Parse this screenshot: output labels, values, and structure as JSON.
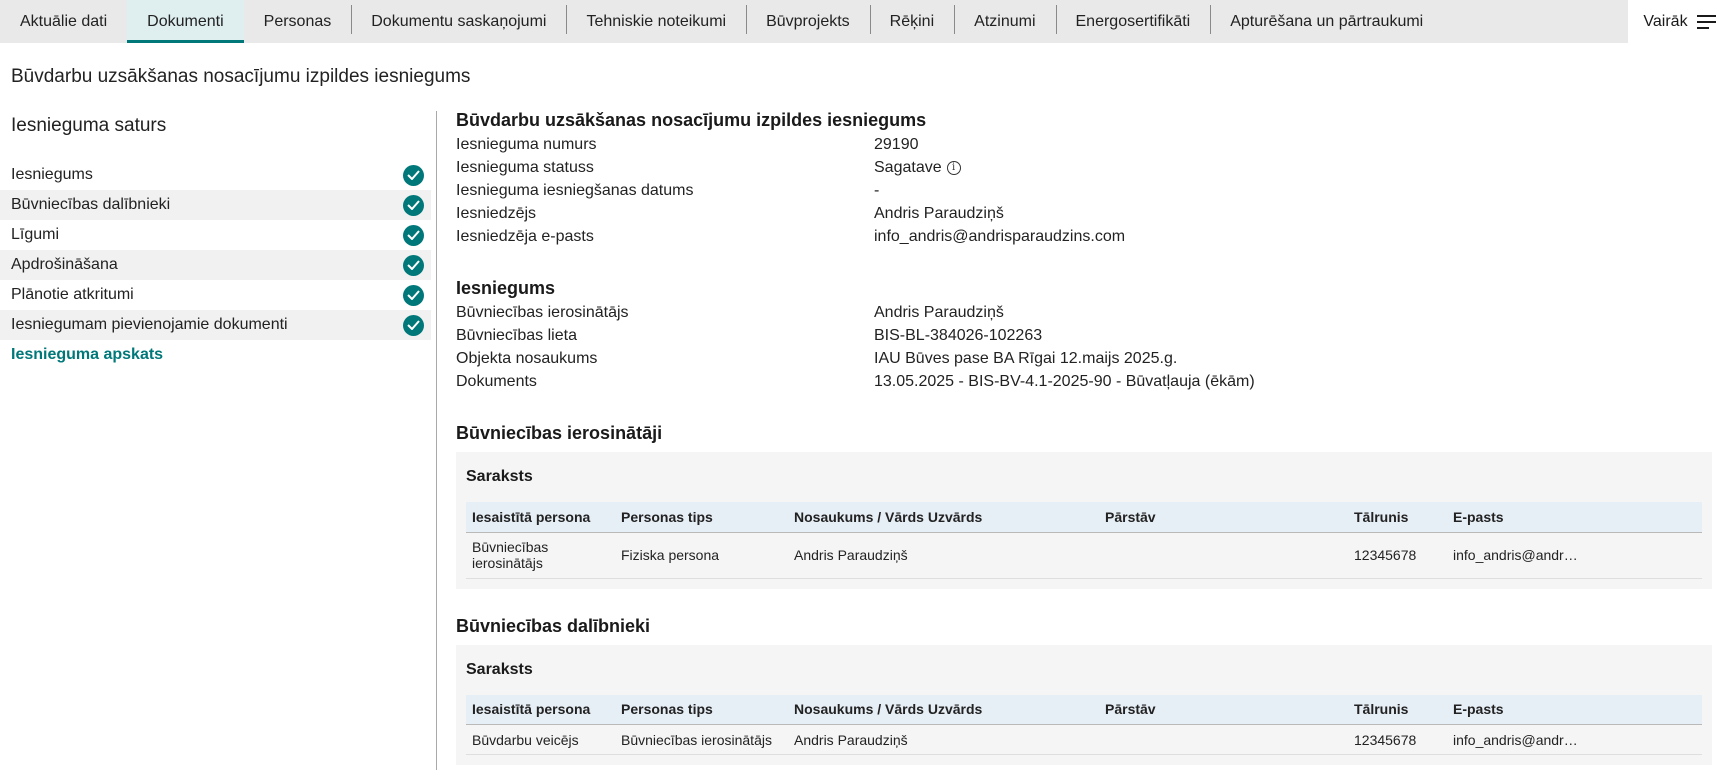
{
  "tabs": [
    {
      "label": "Aktuālie dati"
    },
    {
      "label": "Dokumenti"
    },
    {
      "label": "Personas"
    },
    {
      "label": "Dokumentu saskaņojumi"
    },
    {
      "label": "Tehniskie noteikumi"
    },
    {
      "label": "Būvprojekts"
    },
    {
      "label": "Rēķini"
    },
    {
      "label": "Atzinumi"
    },
    {
      "label": "Energosertifikāti"
    },
    {
      "label": "Apturēšana un pārtraukumi"
    }
  ],
  "active_tab": "Dokumenti",
  "more_label": "Vairāk",
  "page_title": "Būvdarbu uzsākšanas nosacījumu izpildes iesniegums",
  "sidebar": {
    "title": "Iesnieguma saturs",
    "items": [
      {
        "label": "Iesniegums",
        "status": "complete"
      },
      {
        "label": "Būvniecības dalībnieki",
        "status": "complete"
      },
      {
        "label": "Līgumi",
        "status": "complete"
      },
      {
        "label": "Apdrošināšana",
        "status": "complete"
      },
      {
        "label": "Plānotie atkritumi",
        "status": "complete"
      },
      {
        "label": "Iesniegumam pievienojamie dokumenti",
        "status": "complete"
      }
    ],
    "current": "Iesnieguma apskats"
  },
  "main": {
    "summary": {
      "heading": "Būvdarbu uzsākšanas nosacījumu izpildes iesniegums",
      "rows": [
        {
          "key": "Iesnieguma numurs",
          "value": "29190"
        },
        {
          "key": "Iesnieguma statuss",
          "value": "Sagatave"
        },
        {
          "key": "Iesnieguma iesniegšanas datums",
          "value": "-"
        },
        {
          "key": "Iesniedzējs",
          "value": "Andris Paraudziņš"
        },
        {
          "key": "Iesniedzēja e-pasts",
          "value": "info_andris@andrisparaudzins.com"
        }
      ]
    },
    "application": {
      "heading": "Iesniegums",
      "rows": [
        {
          "key": "Būvniecības ierosinātājs",
          "value": "Andris Paraudziņš"
        },
        {
          "key": "Būvniecības lieta",
          "value": "BIS-BL-384026-102263"
        },
        {
          "key": "Objekta nosaukums",
          "value": "IAU Būves pase BA Rīgai 12.maijs 2025.g."
        },
        {
          "key": "Dokuments",
          "value": "13.05.2025 - BIS-BV-4.1-2025-90 - Būvatļauja (ēkām)"
        }
      ]
    },
    "initiators": {
      "heading": "Būvniecības ierosinātāji",
      "panel_title": "Saraksts",
      "columns": [
        "Iesaistītā persona",
        "Personas tips",
        "Nosaukums / Vārds Uzvārds",
        "Pārstāv",
        "Tālrunis",
        "E-pasts"
      ],
      "rows": [
        [
          "Būvniecības ierosinātājs",
          "Fiziska persona",
          "Andris Paraudziņš",
          "",
          "12345678",
          "info_andris@andr…"
        ]
      ]
    },
    "participants": {
      "heading": "Būvniecības dalībnieki",
      "panel_title": "Saraksts",
      "columns": [
        "Iesaistītā persona",
        "Personas tips",
        "Nosaukums / Vārds Uzvārds",
        "Pārstāv",
        "Tālrunis",
        "E-pasts"
      ],
      "rows": [
        [
          "Būvdarbu veicējs",
          "Būvniecības ierosinātājs",
          "Andris Paraudziņš",
          "",
          "12345678",
          "info_andris@andr…"
        ]
      ]
    }
  },
  "colors": {
    "accent": "#00787a",
    "tabbar_bg": "#e9e9e9",
    "active_tab_bg": "#dfeff0",
    "table_header_bg": "#e6eef6",
    "panel_bg": "#f5f5f5"
  },
  "icons": {
    "more": "hamburger-menu-icon",
    "complete": "check-circle-icon",
    "status_info": "info-icon"
  }
}
